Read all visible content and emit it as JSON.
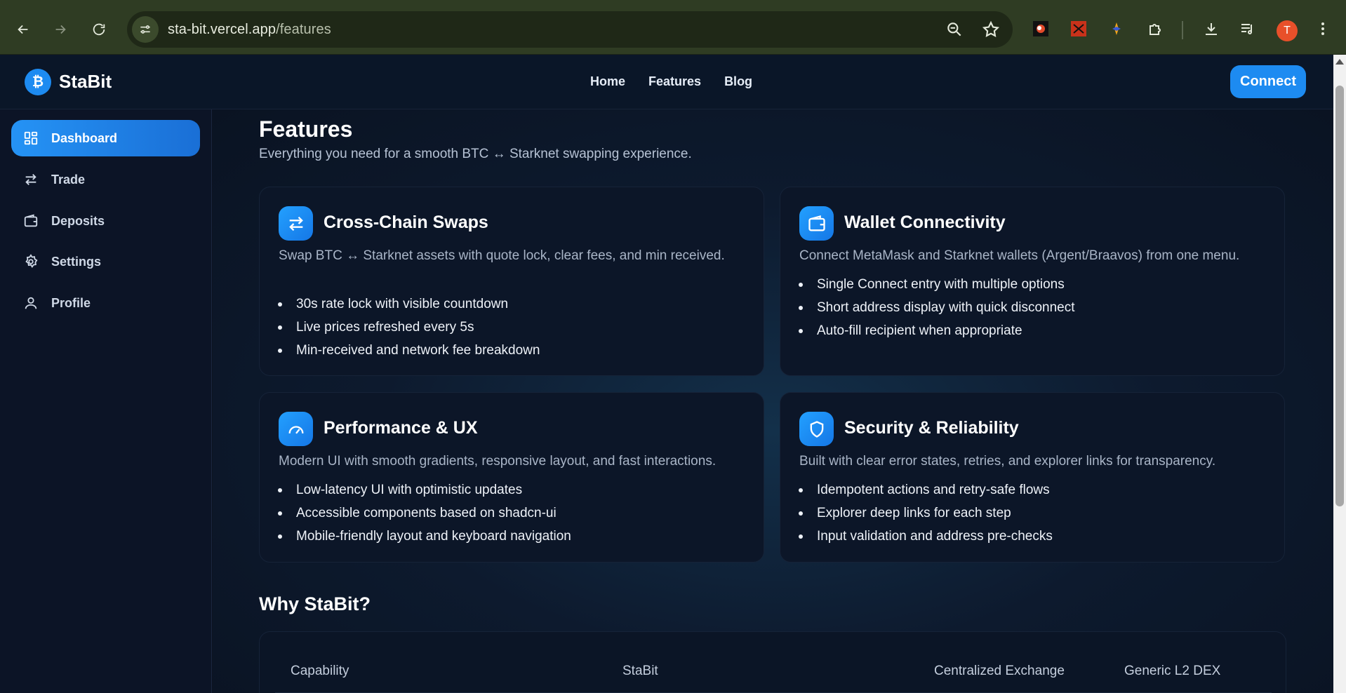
{
  "browser": {
    "url_host": "sta-bit.vercel.app",
    "url_path": "/features",
    "avatar_letter": "T"
  },
  "header": {
    "logo_symbol": "₿",
    "brand": "StaBit",
    "nav": [
      "Home",
      "Features",
      "Blog"
    ],
    "connect_label": "Connect"
  },
  "sidebar": {
    "items": [
      {
        "label": "Dashboard",
        "icon": "dashboard-grid-icon",
        "active": true
      },
      {
        "label": "Trade",
        "icon": "swap-arrows-icon"
      },
      {
        "label": "Deposits",
        "icon": "wallet-icon"
      },
      {
        "label": "Settings",
        "icon": "gear-icon"
      },
      {
        "label": "Profile",
        "icon": "user-icon"
      }
    ]
  },
  "main": {
    "title": "Features",
    "subtitle": "Everything you need for a smooth BTC ↔ Starknet swapping experience.",
    "cards": [
      {
        "icon": "swap-arrows-icon",
        "title": "Cross-Chain Swaps",
        "description": "Swap BTC ↔ Starknet assets with quote lock, clear fees, and min received.",
        "bullets": [
          "30s rate lock with visible countdown",
          "Live prices refreshed every 5s",
          "Min-received and network fee breakdown"
        ]
      },
      {
        "icon": "wallet-icon",
        "title": "Wallet Connectivity",
        "description": "Connect MetaMask and Starknet wallets (Argent/Braavos) from one menu.",
        "bullets": [
          "Single Connect entry with multiple options",
          "Short address display with quick disconnect",
          "Auto-fill recipient when appropriate"
        ]
      },
      {
        "icon": "gauge-icon",
        "title": "Performance & UX",
        "description": "Modern UI with smooth gradients, responsive layout, and fast interactions.",
        "bullets": [
          "Low-latency UI with optimistic updates",
          "Accessible components based on shadcn-ui",
          "Mobile-friendly layout and keyboard navigation"
        ]
      },
      {
        "icon": "shield-icon",
        "title": "Security & Reliability",
        "description": "Built with clear error states, retries, and explorer links for transparency.",
        "bullets": [
          "Idempotent actions and retry-safe flows",
          "Explorer deep links for each step",
          "Input validation and address pre-checks"
        ]
      }
    ],
    "why_title": "Why StaBit?",
    "table_headers": [
      "Capability",
      "StaBit",
      "Centralized Exchange",
      "Generic L2 DEX"
    ]
  },
  "colors": {
    "accent": "#1d8bf1",
    "background": "#0b1220",
    "chrome": "#2f3c23"
  }
}
